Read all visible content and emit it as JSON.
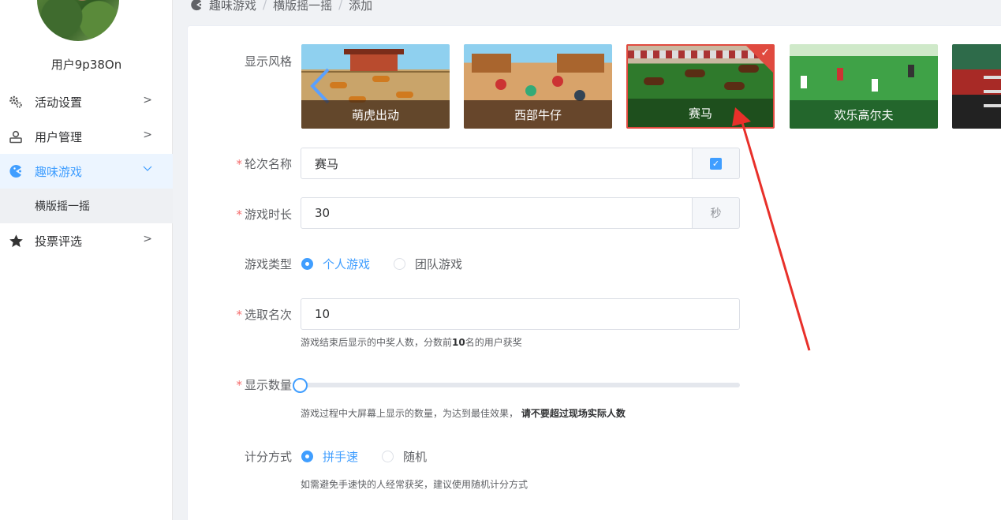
{
  "sidebar": {
    "username": "用户9p38On",
    "items": [
      {
        "label": "活动设置",
        "icon": "gears-icon"
      },
      {
        "label": "用户管理",
        "icon": "user-card-icon"
      },
      {
        "label": "趣味游戏",
        "icon": "pacman-icon"
      },
      {
        "label": "投票评选",
        "icon": "star-icon"
      }
    ],
    "submenu": {
      "label": "横版摇一摇"
    }
  },
  "breadcrumb": {
    "items": [
      "趣味游戏",
      "横版摇一摇",
      "添加"
    ],
    "separator": "/"
  },
  "form": {
    "style": {
      "label": "显示风格",
      "options": [
        "萌虎出动",
        "西部牛仔",
        "赛马",
        "欢乐高尔夫"
      ],
      "selected": "赛马"
    },
    "round_name": {
      "label": "轮次名称",
      "value": "赛马",
      "required": "*",
      "checkbox_mark": "✓"
    },
    "duration": {
      "label": "游戏时长",
      "value": "30",
      "unit": "秒",
      "required": "*"
    },
    "game_type": {
      "label": "游戏类型",
      "options": [
        "个人游戏",
        "团队游戏"
      ],
      "selected": "个人游戏"
    },
    "winners": {
      "label": "选取名次",
      "value": "10",
      "required": "*",
      "hint_pre": "游戏结束后显示的中奖人数，分数前",
      "hint_num": "10",
      "hint_post": "名的用户获奖"
    },
    "display_count": {
      "label": "显示数量",
      "required": "*",
      "level": 0,
      "hint": "游戏过程中大屏幕上显示的数量，为达到最佳效果，",
      "hint_bold": "请不要超过现场实际人数"
    },
    "scoring": {
      "label": "计分方式",
      "options": [
        "拼手速",
        "随机"
      ],
      "selected": "拼手速",
      "hint": "如需避免手速快的人经常获奖，建议使用随机计分方式"
    }
  },
  "colors": {
    "primary": "#409eff",
    "required": "#f56c6c",
    "arrow": "#e8302a"
  }
}
